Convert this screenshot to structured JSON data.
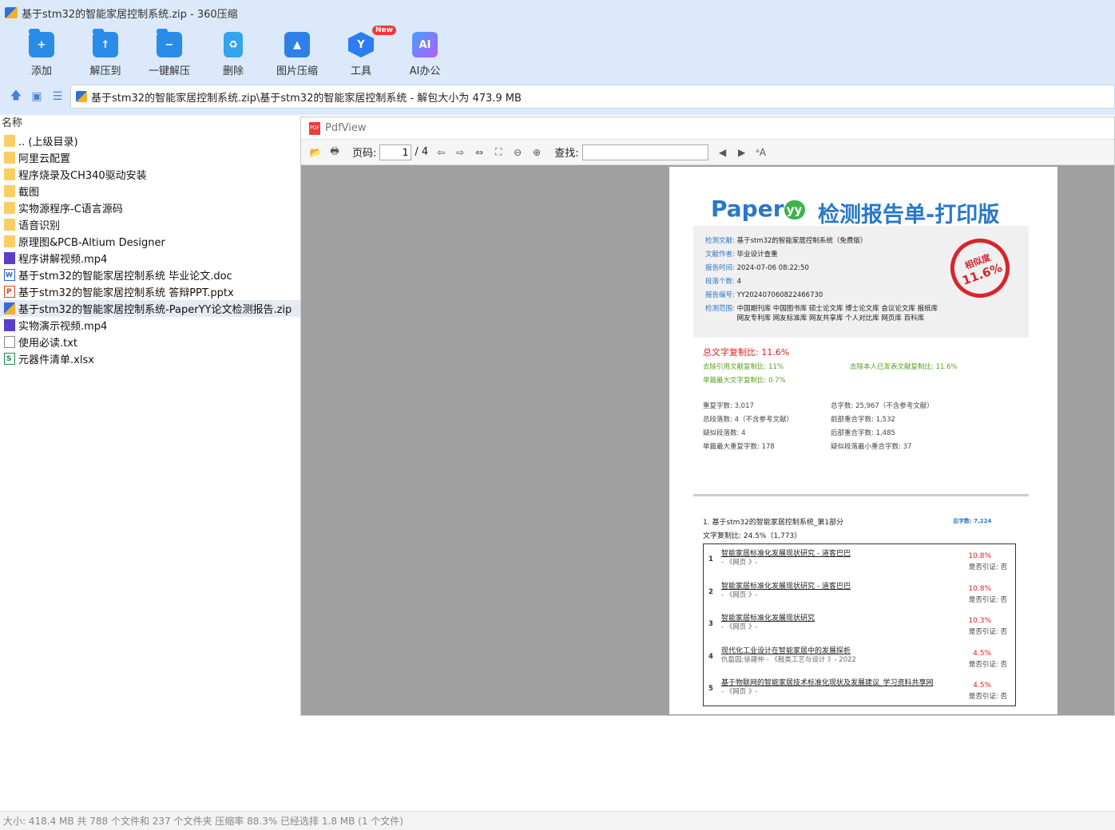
{
  "window": {
    "title": "基于stm32的智能家居控制系统.zip - 360压缩"
  },
  "toolbar": {
    "items": [
      {
        "label": "添加",
        "icon": "add-folder-icon"
      },
      {
        "label": "解压到",
        "icon": "extract-to-icon"
      },
      {
        "label": "一键解压",
        "icon": "one-click-extract-icon"
      },
      {
        "label": "删除",
        "icon": "delete-bin-icon"
      },
      {
        "label": "图片压缩",
        "icon": "image-compress-icon"
      },
      {
        "label": "工具",
        "icon": "tools-icon",
        "badge": "New"
      },
      {
        "label": "AI办公",
        "icon": "ai-office-icon",
        "glyph": "AI"
      }
    ]
  },
  "address": {
    "path": "基于stm32的智能家居控制系统.zip\\基于stm32的智能家居控制系统 - 解包大小为 473.9 MB"
  },
  "filelist": {
    "header": "名称",
    "items": [
      {
        "name": ".. (上级目录)",
        "type": "folder"
      },
      {
        "name": "阿里云配置",
        "type": "folder"
      },
      {
        "name": "程序烧录及CH340驱动安装",
        "type": "folder"
      },
      {
        "name": "截图",
        "type": "folder"
      },
      {
        "name": "实物源程序-C语言源码",
        "type": "folder"
      },
      {
        "name": "语音识别",
        "type": "folder"
      },
      {
        "name": "原理图&PCB-Altium Designer",
        "type": "folder"
      },
      {
        "name": "程序讲解视频.mp4",
        "type": "mp4"
      },
      {
        "name": "基于stm32的智能家居控制系统 毕业论文.doc",
        "type": "doc"
      },
      {
        "name": "基于stm32的智能家居控制系统 答辩PPT.pptx",
        "type": "ppt"
      },
      {
        "name": "基于stm32的智能家居控制系统-PaperYY论文检测报告.zip",
        "type": "zip",
        "selected": true
      },
      {
        "name": "实物演示视频.mp4",
        "type": "mp4"
      },
      {
        "name": "使用必读.txt",
        "type": "txt"
      },
      {
        "name": "元器件清单.xlsx",
        "type": "xlsx"
      }
    ]
  },
  "pdfview": {
    "title": "PdfView",
    "page_label": "页码:",
    "page_current": "1",
    "page_total": "/ 4",
    "find_label": "查找:",
    "find_value": ""
  },
  "report": {
    "logo": "Paper",
    "logo_yy": "yy",
    "title": "检测报告单-打印版",
    "doc_label": "检测文献:",
    "doc_value": "基于stm32的智能家居控制系统（免费版）",
    "author_label": "文献作者:",
    "author_value": "毕业设计查重",
    "time_label": "报告时间:",
    "time_value": "2024-07-06 08:22:50",
    "paras_label": "段落个数:",
    "paras_value": "4",
    "id_label": "报告编号:",
    "id_value": "YY202407060822466730",
    "scope_label": "检测范围:",
    "scope_line1": "中国期刊库 中国图书库 硕士论文库 博士论文库 会议论文库 报纸库",
    "scope_line2": "网友专利库 网友标准库 网友共享库 个人对比库 网页库 百科库",
    "seal_line1": "相似度",
    "seal_line2": "11.6%",
    "total_ratio": "总文字复制比: 11.6%",
    "exclude_ref": "去除引用文献复制比: 11%",
    "exclude_self": "去除本人已发表文献复制比: 11.6%",
    "single_max": "单篇最大文字复制比: 0.7%",
    "stats": {
      "repeat": "重复字数: 3,017",
      "total_chars": "总字数: 25,967（不含参考文献）",
      "total_paras": "总段落数: 4（不含参考文献）",
      "front_overlap": "前部重合字数: 1,532",
      "similar_paras": "疑似段落数: 4",
      "back_overlap": "后部重合字数: 1,485",
      "single_max_repeat": "单篇最大重复字数: 178",
      "min_overlap": "疑似段落最小重合字数: 37"
    },
    "section_title": "1. 基于stm32的智能家居控制系统_第1部分",
    "section_count": "总字数: 7,224",
    "section_ratio": "文字复制比: 24.5%（1,773）",
    "sources": [
      {
        "num": "1",
        "title": "智能家居标准化发展现状研究 - 道客巴巴",
        "sub": "- 《网页 》-",
        "pct": "10.8%",
        "cite": "是否引证: 否"
      },
      {
        "num": "2",
        "title": "智能家居标准化发展现状研究 - 道客巴巴",
        "sub": "- 《网页 》-",
        "pct": "10.8%",
        "cite": "是否引证: 否"
      },
      {
        "num": "3",
        "title": "智能家居标准化发展现状研究",
        "sub": "- 《网页 》-",
        "pct": "10.3%",
        "cite": "是否引证: 否"
      },
      {
        "num": "4",
        "title": "现代化工业设计在智能家居中的发展探析",
        "sub": "仇盈园;徐建仲 - 《鞋类工艺与设计 》- 2022",
        "pct": "4.5%",
        "cite": "是否引证: 否"
      },
      {
        "num": "5",
        "title": "基于物联网的智能家居技术标准化现状及发展建议_学习资料共享网",
        "sub": "- 《网页 》-",
        "pct": "4.5%",
        "cite": "是否引证: 否"
      }
    ]
  },
  "status": {
    "text": "大小: 418.4 MB 共 788 个文件和 237 个文件夹 压缩率 88.3% 已经选择 1.8 MB (1 个文件)"
  }
}
